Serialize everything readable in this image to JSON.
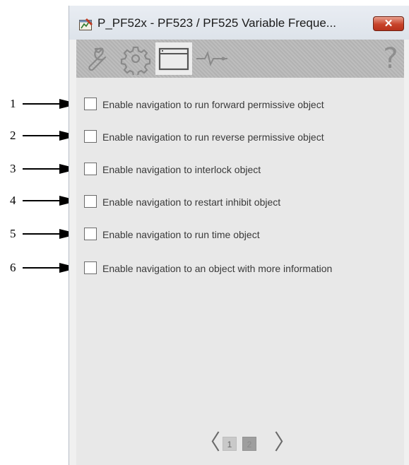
{
  "window": {
    "title": "P_PF52x - PF523 / PF525 Variable Freque...",
    "close_label": "✕"
  },
  "tabs": [
    {
      "icon": "wrench-icon"
    },
    {
      "icon": "gear-icon"
    },
    {
      "icon": "window-icon",
      "active": true
    },
    {
      "icon": "trend-icon"
    }
  ],
  "help_label": "?",
  "options": [
    {
      "callout": "1",
      "label": "Enable navigation to run forward permissive object",
      "checked": false
    },
    {
      "callout": "2",
      "label": "Enable navigation to run reverse permissive object",
      "checked": false
    },
    {
      "callout": "3",
      "label": "Enable navigation to interlock object",
      "checked": false
    },
    {
      "callout": "4",
      "label": "Enable navigation to restart inhibit object",
      "checked": false
    },
    {
      "callout": "5",
      "label": "Enable navigation to run time object",
      "checked": false
    },
    {
      "callout": "6",
      "label": "Enable navigation to an object with more information",
      "checked": false
    }
  ],
  "pager": {
    "prev": "〈",
    "next": "〉",
    "pages": [
      "1",
      "2"
    ],
    "current": "2"
  }
}
